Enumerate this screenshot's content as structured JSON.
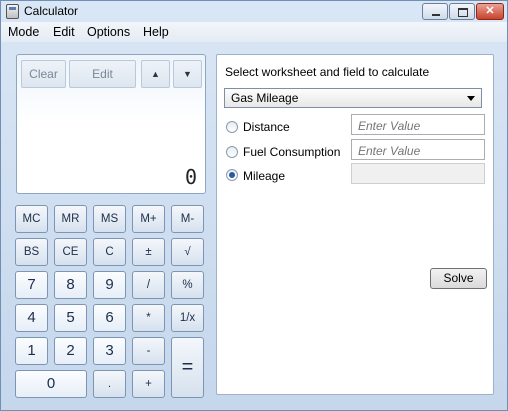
{
  "window": {
    "title": "Calculator",
    "close_glyph": "✕"
  },
  "menu": [
    "Mode",
    "Edit",
    "Options",
    "Help"
  ],
  "memory_history": {
    "clear": "Clear",
    "edit": "Edit",
    "up": "▲",
    "down": "▼"
  },
  "display": {
    "value": "0"
  },
  "keys": {
    "mc": "MC",
    "mr": "MR",
    "ms": "MS",
    "mplus": "M+",
    "mminus": "M-",
    "bs": "BS",
    "ce": "CE",
    "c": "C",
    "plusminus": "±",
    "sqrt": "√",
    "7": "7",
    "8": "8",
    "9": "9",
    "div": "/",
    "pct": "%",
    "4": "4",
    "5": "5",
    "6": "6",
    "mul": "*",
    "recip": "1/x",
    "1": "1",
    "2": "2",
    "3": "3",
    "sub": "-",
    "eq": "=",
    "0": "0",
    "dot": ".",
    "add": "+"
  },
  "worksheet": {
    "heading": "Select worksheet and field to calculate",
    "selected": "Gas Mileage",
    "fields": [
      {
        "label": "Distance",
        "placeholder": "Enter Value",
        "checked": false
      },
      {
        "label": "Fuel Consumption",
        "placeholder": "Enter Value",
        "checked": false
      },
      {
        "label": "Mileage",
        "placeholder": "",
        "checked": true
      }
    ],
    "solve_label": "Solve"
  }
}
